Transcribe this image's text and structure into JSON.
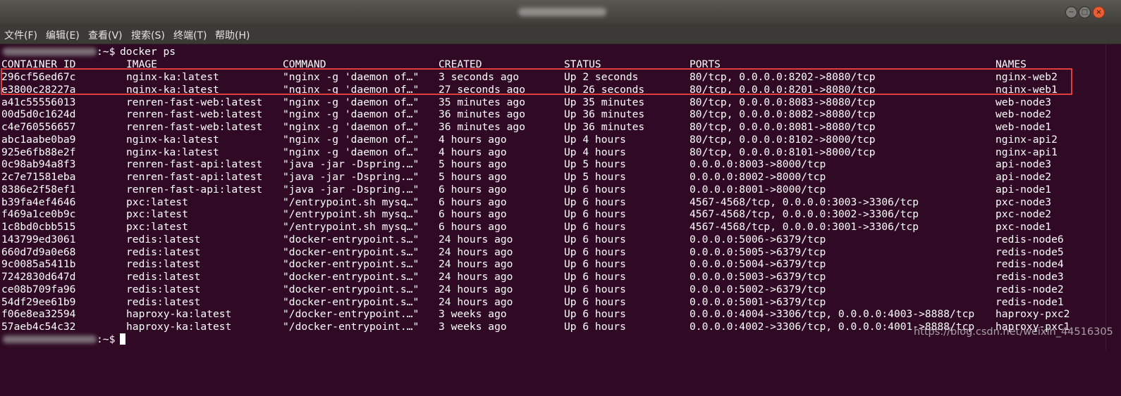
{
  "menu": [
    "文件(F)",
    "编辑(E)",
    "查看(V)",
    "搜索(S)",
    "终端(T)",
    "帮助(H)"
  ],
  "window_controls": {
    "minimize": "−",
    "maximize": "□",
    "close": "×"
  },
  "prompt": {
    "suffix": ":~$ ",
    "command": "docker ps"
  },
  "table": {
    "headers": [
      "CONTAINER ID",
      "IMAGE",
      "COMMAND",
      "CREATED",
      "STATUS",
      "PORTS",
      "NAMES"
    ],
    "rows": [
      [
        "296cf56ed67c",
        "nginx-ka:latest",
        "\"nginx -g 'daemon of…\"",
        "3 seconds ago",
        "Up 2 seconds",
        "80/tcp, 0.0.0.0:8202->8080/tcp",
        "nginx-web2"
      ],
      [
        "e3800c28227a",
        "nginx-ka:latest",
        "\"nginx -g 'daemon of…\"",
        "27 seconds ago",
        "Up 26 seconds",
        "80/tcp, 0.0.0.0:8201->8080/tcp",
        "nginx-web1"
      ],
      [
        "a41c55556013",
        "renren-fast-web:latest",
        "\"nginx -g 'daemon of…\"",
        "35 minutes ago",
        "Up 35 minutes",
        "80/tcp, 0.0.0.0:8083->8080/tcp",
        "web-node3"
      ],
      [
        "00d5d0c1624d",
        "renren-fast-web:latest",
        "\"nginx -g 'daemon of…\"",
        "36 minutes ago",
        "Up 36 minutes",
        "80/tcp, 0.0.0.0:8082->8080/tcp",
        "web-node2"
      ],
      [
        "c4e760556657",
        "renren-fast-web:latest",
        "\"nginx -g 'daemon of…\"",
        "36 minutes ago",
        "Up 36 minutes",
        "80/tcp, 0.0.0.0:8081->8080/tcp",
        "web-node1"
      ],
      [
        "abc1aabe0ba9",
        "nginx-ka:latest",
        "\"nginx -g 'daemon of…\"",
        "4 hours ago",
        "Up 4 hours",
        "80/tcp, 0.0.0.0:8102->8000/tcp",
        "nginx-api2"
      ],
      [
        "925e6fb88e2f",
        "nginx-ka:latest",
        "\"nginx -g 'daemon of…\"",
        "4 hours ago",
        "Up 4 hours",
        "80/tcp, 0.0.0.0:8101->8000/tcp",
        "nginx-api1"
      ],
      [
        "0c98ab94a8f3",
        "renren-fast-api:latest",
        "\"java -jar -Dspring.…\"",
        "5 hours ago",
        "Up 5 hours",
        "0.0.0.0:8003->8000/tcp",
        "api-node3"
      ],
      [
        "2c7e71581eba",
        "renren-fast-api:latest",
        "\"java -jar -Dspring.…\"",
        "5 hours ago",
        "Up 5 hours",
        "0.0.0.0:8002->8000/tcp",
        "api-node2"
      ],
      [
        "8386e2f58ef1",
        "renren-fast-api:latest",
        "\"java -jar -Dspring.…\"",
        "6 hours ago",
        "Up 6 hours",
        "0.0.0.0:8001->8000/tcp",
        "api-node1"
      ],
      [
        "b39fa4ef4646",
        "pxc:latest",
        "\"/entrypoint.sh mysq…\"",
        "6 hours ago",
        "Up 6 hours",
        "4567-4568/tcp, 0.0.0.0:3003->3306/tcp",
        "pxc-node3"
      ],
      [
        "f469a1ce0b9c",
        "pxc:latest",
        "\"/entrypoint.sh mysq…\"",
        "6 hours ago",
        "Up 6 hours",
        "4567-4568/tcp, 0.0.0.0:3002->3306/tcp",
        "pxc-node2"
      ],
      [
        "1c8bd0cbb515",
        "pxc:latest",
        "\"/entrypoint.sh mysq…\"",
        "6 hours ago",
        "Up 6 hours",
        "4567-4568/tcp, 0.0.0.0:3001->3306/tcp",
        "pxc-node1"
      ],
      [
        "143799ed3061",
        "redis:latest",
        "\"docker-entrypoint.s…\"",
        "24 hours ago",
        "Up 6 hours",
        "0.0.0.0:5006->6379/tcp",
        "redis-node6"
      ],
      [
        "660d7d9a0e68",
        "redis:latest",
        "\"docker-entrypoint.s…\"",
        "24 hours ago",
        "Up 6 hours",
        "0.0.0.0:5005->6379/tcp",
        "redis-node5"
      ],
      [
        "9c0085a5411b",
        "redis:latest",
        "\"docker-entrypoint.s…\"",
        "24 hours ago",
        "Up 6 hours",
        "0.0.0.0:5004->6379/tcp",
        "redis-node4"
      ],
      [
        "7242830d647d",
        "redis:latest",
        "\"docker-entrypoint.s…\"",
        "24 hours ago",
        "Up 6 hours",
        "0.0.0.0:5003->6379/tcp",
        "redis-node3"
      ],
      [
        "ce08b709fa96",
        "redis:latest",
        "\"docker-entrypoint.s…\"",
        "24 hours ago",
        "Up 6 hours",
        "0.0.0.0:5002->6379/tcp",
        "redis-node2"
      ],
      [
        "54df29ee61b9",
        "redis:latest",
        "\"docker-entrypoint.s…\"",
        "24 hours ago",
        "Up 6 hours",
        "0.0.0.0:5001->6379/tcp",
        "redis-node1"
      ],
      [
        "f06e8ea32594",
        "haproxy-ka:latest",
        "\"/docker-entrypoint.…\"",
        "3 weeks ago",
        "Up 6 hours",
        "0.0.0.0:4004->3306/tcp, 0.0.0.0:4003->8888/tcp",
        "haproxy-pxc2"
      ],
      [
        "57aeb4c54c32",
        "haproxy-ka:latest",
        "\"/docker-entrypoint.…\"",
        "3 weeks ago",
        "Up 6 hours",
        "0.0.0.0:4002->3306/tcp, 0.0.0.0:4001->8888/tcp",
        "haproxy-pxc1"
      ]
    ]
  },
  "final_prompt": {
    "suffix": ":~$ "
  },
  "watermark": "https://blog.csdn.net/weixin_44516305",
  "colors": {
    "terminal_bg": "#300a24",
    "text": "#ffffff",
    "highlight": "#e03d3d"
  }
}
